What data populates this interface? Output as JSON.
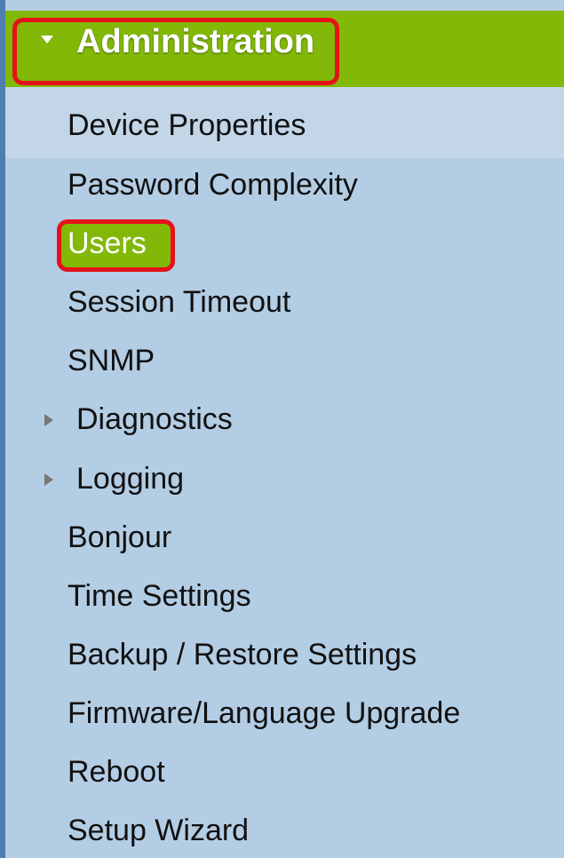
{
  "menu": {
    "section_title": "Administration",
    "items": [
      {
        "label": "Device Properties"
      },
      {
        "label": "Password Complexity"
      },
      {
        "label": "Users",
        "selected": true
      },
      {
        "label": "Session Timeout"
      },
      {
        "label": "SNMP"
      },
      {
        "label": "Diagnostics",
        "expandable": true,
        "expanded": false
      },
      {
        "label": "Logging",
        "expandable": true,
        "expanded": false
      },
      {
        "label": "Bonjour"
      },
      {
        "label": "Time Settings"
      },
      {
        "label": "Backup / Restore Settings"
      },
      {
        "label": "Firmware/Language Upgrade"
      },
      {
        "label": "Reboot"
      },
      {
        "label": "Setup Wizard"
      }
    ]
  },
  "colors": {
    "header_green": "#82b807",
    "highlight_red": "#e5121a",
    "sidebar_blue": "#b3cde4",
    "left_border_blue": "#4f7fae"
  },
  "icons": {
    "section_expanded": "caret-down-icon",
    "item_collapsed": "caret-right-icon"
  }
}
